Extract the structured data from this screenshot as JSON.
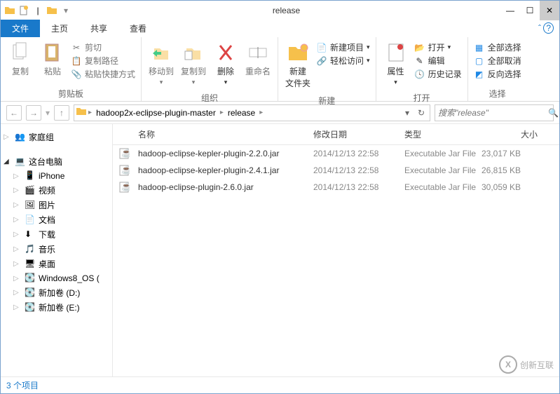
{
  "window": {
    "title": "release"
  },
  "tabs": {
    "file": "文件",
    "home": "主页",
    "share": "共享",
    "view": "查看"
  },
  "ribbon": {
    "clipboard": {
      "label": "剪贴板",
      "copy": "复制",
      "paste": "粘贴",
      "cut": "剪切",
      "copypath": "复制路径",
      "pasteshortcut": "粘贴快捷方式"
    },
    "organize": {
      "label": "组织",
      "moveto": "移动到",
      "copyto": "复制到",
      "delete": "删除",
      "rename": "重命名"
    },
    "new": {
      "label": "新建",
      "newfolder": "新建\n文件夹",
      "newitem": "新建项目",
      "easyaccess": "轻松访问"
    },
    "open": {
      "label": "打开",
      "properties": "属性",
      "open": "打开",
      "edit": "编辑",
      "history": "历史记录"
    },
    "select": {
      "label": "选择",
      "selectall": "全部选择",
      "selectnone": "全部取消",
      "invert": "反向选择"
    }
  },
  "address": {
    "segments": [
      "hadoop2x-eclipse-plugin-master",
      "release"
    ],
    "search_placeholder": "搜索\"release\""
  },
  "navpane": {
    "homegroup": "家庭组",
    "thispc": "这台电脑",
    "items": [
      "iPhone",
      "视频",
      "图片",
      "文档",
      "下载",
      "音乐",
      "桌面",
      "Windows8_OS (",
      "新加卷 (D:)",
      "新加卷 (E:)"
    ]
  },
  "columns": {
    "name": "名称",
    "date": "修改日期",
    "type": "类型",
    "size": "大小"
  },
  "files": [
    {
      "name": "hadoop-eclipse-kepler-plugin-2.2.0.jar",
      "date": "2014/12/13 22:58",
      "type": "Executable Jar File",
      "size": "23,017 KB"
    },
    {
      "name": "hadoop-eclipse-kepler-plugin-2.4.1.jar",
      "date": "2014/12/13 22:58",
      "type": "Executable Jar File",
      "size": "26,815 KB"
    },
    {
      "name": "hadoop-eclipse-plugin-2.6.0.jar",
      "date": "2014/12/13 22:58",
      "type": "Executable Jar File",
      "size": "30,059 KB"
    }
  ],
  "status": "3 个项目",
  "watermark": "创新互联"
}
